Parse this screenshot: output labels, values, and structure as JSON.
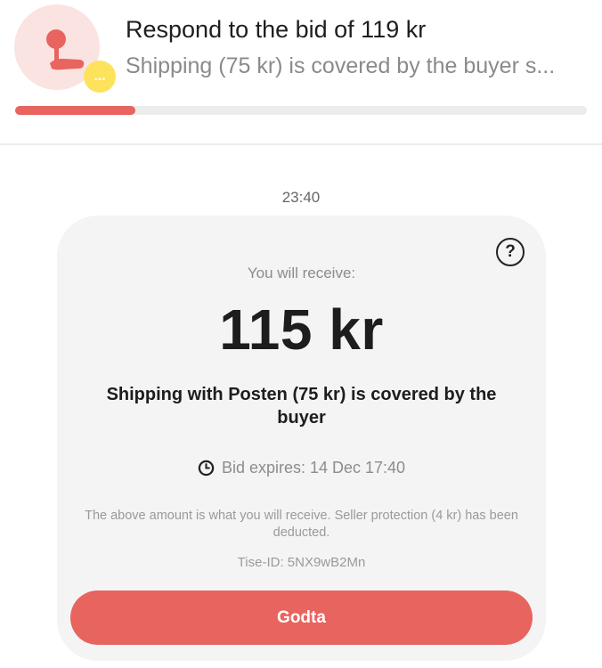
{
  "header": {
    "title": "Respond to the bid of 119 kr",
    "subtitle": "Shipping (75 kr) is covered by the buyer s...",
    "badge": "...",
    "progress_fraction": 0.21,
    "avatar_icon": "pin-hand-icon",
    "badge_icon": "chat-dots-icon"
  },
  "message": {
    "timestamp": "23:40"
  },
  "card": {
    "help_icon": "help-icon",
    "help_label": "?",
    "receive_label": "You will receive:",
    "amount": "115 kr",
    "shipping_text": "Shipping with Posten (75 kr) is covered by the buyer",
    "clock_icon": "clock-icon",
    "expires_text": "Bid expires: 14 Dec 17:40",
    "note": "The above amount is what you will receive. Seller protection (4 kr) has been deducted.",
    "tise_id": "Tise-ID: 5NX9wB2Mn",
    "accept_label": "Godta"
  },
  "colors": {
    "accent": "#e8645f",
    "avatar_bg": "#fbe3e1",
    "badge": "#fde25b",
    "card_bg": "#f4f4f4",
    "track": "#ececec"
  }
}
